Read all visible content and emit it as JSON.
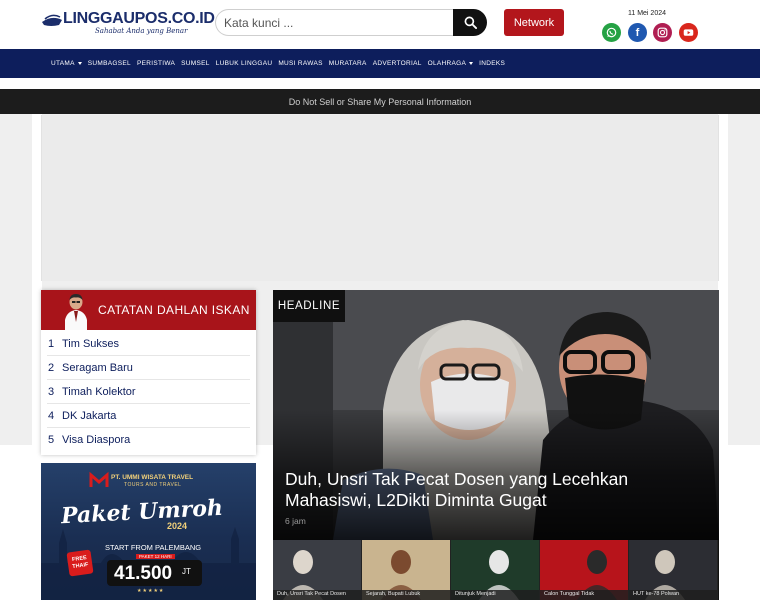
{
  "header": {
    "logo_text": "LINGGAUPOS.CO.ID",
    "logo_tagline": "Sahabat Anda yang Benar",
    "search": {
      "placeholder": "Kata kunci ..."
    },
    "network_label": "Network",
    "date": "11 Mei 2024",
    "social": [
      {
        "icon": "whatsapp-icon",
        "color": "#25a244"
      },
      {
        "icon": "facebook-icon",
        "color": "#1f58b0"
      },
      {
        "icon": "instagram-icon",
        "color": "#b01e52"
      },
      {
        "icon": "youtube-icon",
        "color": "#d9261c"
      }
    ]
  },
  "nav": {
    "items": [
      {
        "label": "UTAMA",
        "has_dropdown": true
      },
      {
        "label": "SUMBAGSEL",
        "has_dropdown": false
      },
      {
        "label": "PERISTIWA",
        "has_dropdown": false
      },
      {
        "label": "SUMSEL",
        "has_dropdown": false
      },
      {
        "label": "LUBUK LINGGAU",
        "has_dropdown": false
      },
      {
        "label": "MUSI RAWAS",
        "has_dropdown": false
      },
      {
        "label": "MURATARA",
        "has_dropdown": false
      },
      {
        "label": "ADVERTORIAL",
        "has_dropdown": false
      },
      {
        "label": "OLAHRAGA",
        "has_dropdown": true
      },
      {
        "label": "INDEKS",
        "has_dropdown": false
      }
    ]
  },
  "privacy": {
    "label": "Do Not Sell or Share My Personal Information"
  },
  "dahlan": {
    "title": "CATATAN DAHLAN ISKAN",
    "items": [
      {
        "num": "1",
        "label": "Tim Sukses"
      },
      {
        "num": "2",
        "label": "Seragam Baru"
      },
      {
        "num": "3",
        "label": "Timah Kolektor"
      },
      {
        "num": "4",
        "label": "DK Jakarta"
      },
      {
        "num": "5",
        "label": "Visa Diaspora"
      }
    ]
  },
  "promo": {
    "brand": "PT. UMMI WISATA TRAVEL",
    "brand_sub": "TOURS AND TRAVEL",
    "script": "Paket Umroh",
    "year": "2024",
    "start": "START FROM PALEMBANG",
    "badge": "FREE THAIF",
    "tag": "PAKET 12 HARI",
    "price": "41.500",
    "price_unit": "JT",
    "stars": "★★★★★"
  },
  "headline": {
    "tag": "HEADLINE",
    "title": "Duh, Unsri Tak Pecat Dosen yang Lecehkan Mahasiswi, L2Dikti Diminta Gugat",
    "time": "6 jam"
  },
  "thumbs": [
    {
      "caption": "Duh, Unsri Tak Pecat Dosen"
    },
    {
      "caption": "Sejarah, Bupati Lubuk"
    },
    {
      "caption": "Ditunjuk Menjadi"
    },
    {
      "caption": "Calon Tunggal Tidak"
    },
    {
      "caption": "HUT ke-78 Polwan"
    }
  ]
}
